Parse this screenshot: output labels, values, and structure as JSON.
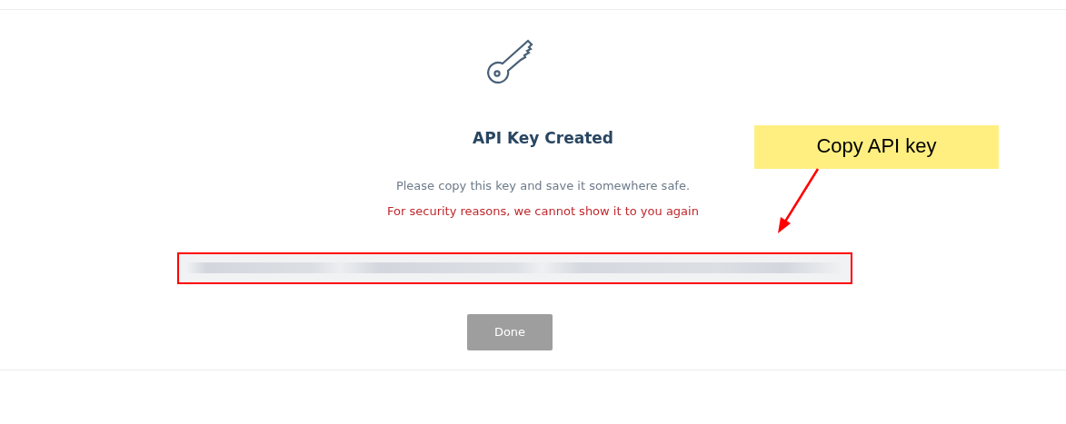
{
  "dialog": {
    "title": "API Key Created",
    "message": "Please copy this key and save it somewhere safe.",
    "warning": "For security reasons, we cannot show it to you again",
    "done_button": {
      "label": "Done",
      "disabled": true
    }
  },
  "annotation": {
    "label": "Copy API key"
  }
}
